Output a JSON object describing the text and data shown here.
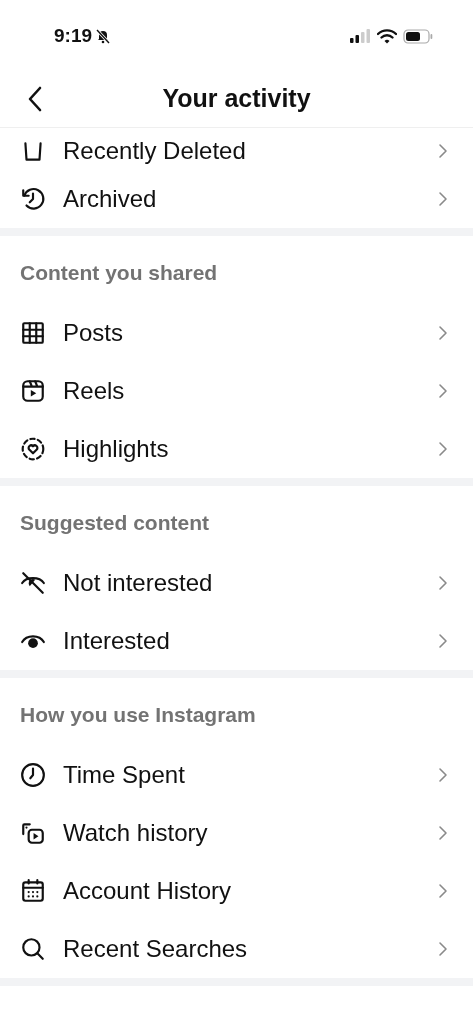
{
  "status_bar": {
    "time": "9:19"
  },
  "header": {
    "title": "Your activity"
  },
  "sections": [
    {
      "items": [
        {
          "label": "Recently Deleted",
          "kind": "trash",
          "clipped": true
        },
        {
          "label": "Archived",
          "kind": "history",
          "clipped": false
        }
      ]
    },
    {
      "heading": "Content you shared",
      "items": [
        {
          "label": "Posts",
          "kind": "grid",
          "clipped": false
        },
        {
          "label": "Reels",
          "kind": "reels",
          "clipped": false
        },
        {
          "label": "Highlights",
          "kind": "highlights",
          "clipped": false
        }
      ]
    },
    {
      "heading": "Suggested content",
      "items": [
        {
          "label": "Not interested",
          "kind": "eye_off",
          "clipped": false
        },
        {
          "label": "Interested",
          "kind": "eye",
          "clipped": false
        }
      ]
    },
    {
      "heading": "How you use Instagram",
      "items": [
        {
          "label": "Time Spent",
          "kind": "clock",
          "clipped": false
        },
        {
          "label": "Watch history",
          "kind": "watch",
          "clipped": false
        },
        {
          "label": "Account History",
          "kind": "calendar",
          "clipped": false
        },
        {
          "label": "Recent Searches",
          "kind": "search",
          "clipped": false
        }
      ]
    }
  ]
}
